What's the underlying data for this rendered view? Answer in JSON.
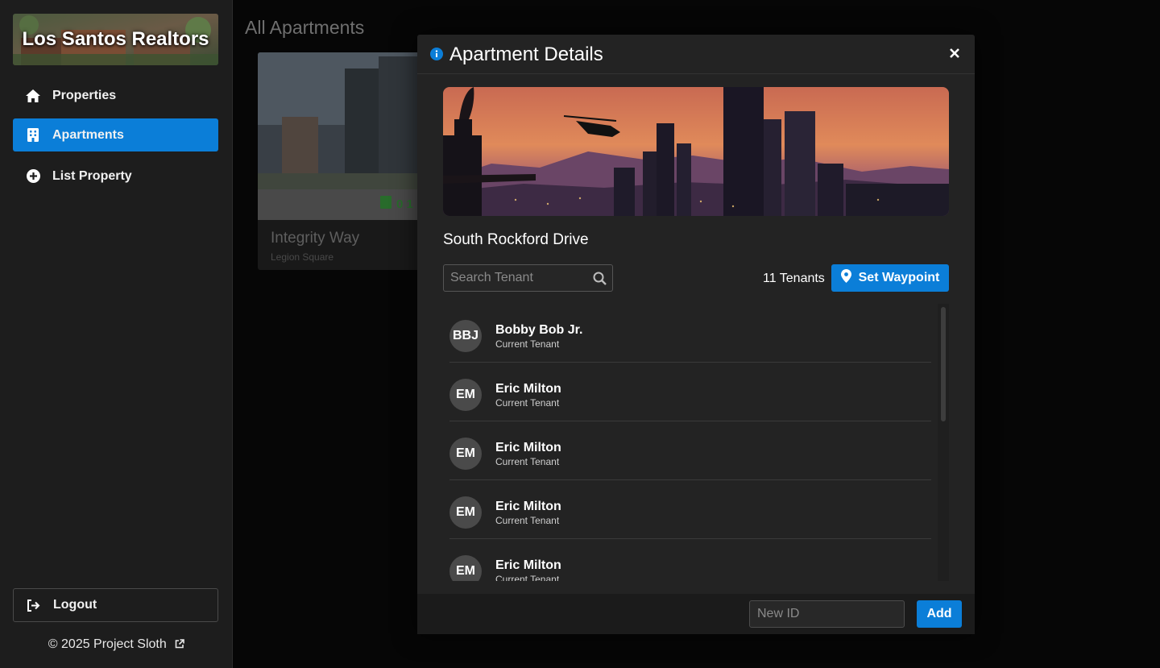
{
  "sidebar": {
    "brand": "Los Santos Realtors",
    "nav": [
      {
        "label": "Properties",
        "icon": "home-icon"
      },
      {
        "label": "Apartments",
        "icon": "building-icon",
        "active": true
      },
      {
        "label": "List Property",
        "icon": "plus-circle-icon"
      }
    ],
    "logout": "Logout",
    "copyright": "© 2025 Project Sloth"
  },
  "main": {
    "title": "All Apartments",
    "card": {
      "name": "Integrity Way",
      "area": "Legion Square",
      "badge": "0 1"
    }
  },
  "modal": {
    "title": "Apartment Details",
    "apartment_name": "South Rockford Drive",
    "search_placeholder": "Search Tenant",
    "tenant_count": "11 Tenants",
    "waypoint_label": "Set Waypoint",
    "tenants": [
      {
        "initials": "BBJ",
        "name": "Bobby Bob Jr.",
        "role": "Current Tenant"
      },
      {
        "initials": "EM",
        "name": "Eric Milton",
        "role": "Current Tenant"
      },
      {
        "initials": "EM",
        "name": "Eric Milton",
        "role": "Current Tenant"
      },
      {
        "initials": "EM",
        "name": "Eric Milton",
        "role": "Current Tenant"
      },
      {
        "initials": "EM",
        "name": "Eric Milton",
        "role": "Current Tenant"
      }
    ],
    "new_id_placeholder": "New ID",
    "add_label": "Add"
  },
  "colors": {
    "accent": "#0b7ed8",
    "sidebar_bg": "#1d1d1d",
    "modal_bg": "#232323"
  }
}
